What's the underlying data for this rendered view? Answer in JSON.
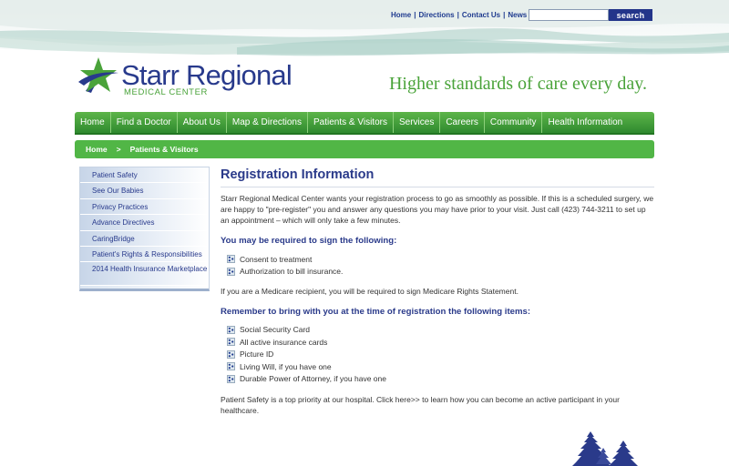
{
  "utility_nav": {
    "links": [
      "Home",
      "Directions",
      "Contact Us",
      "News"
    ],
    "separator": "|",
    "search_placeholder": "",
    "search_button": "search"
  },
  "logo": {
    "name": "Starr Regional",
    "subtitle": "MEDICAL CENTER",
    "icon": "star-logo-icon",
    "colors": {
      "blue": "#283a8c",
      "green": "#4aa33a"
    }
  },
  "tagline": "Higher standards of care every day.",
  "main_nav": [
    "Home",
    "Find a Doctor",
    "About Us",
    "Map & Directions",
    "Patients & Visitors",
    "Services",
    "Careers",
    "Community",
    "Health Information"
  ],
  "breadcrumb": {
    "items": [
      "Home",
      "Patients & Visitors"
    ],
    "separator": ">"
  },
  "sidebar": {
    "items": [
      "Patient Safety",
      "See Our Babies",
      "Privacy Practices",
      "Advance Directives",
      "CaringBridge",
      "Patient's Rights & Responsibilities",
      "2014 Health Insurance Marketplace"
    ]
  },
  "content": {
    "title": "Registration Information",
    "intro": "Starr Regional Medical Center wants your registration process to go as smoothly as possible. If this is a scheduled surgery, we are happy to \"pre-register\" you and answer any questions you may have prior to your visit. Just call (423) 744-3211 to set up an appointment – which will only take a few minutes.",
    "sign_heading": "You may be required to sign the following:",
    "sign_items": [
      "Consent to treatment",
      "Authorization to bill insurance."
    ],
    "medicare_note": "If you are a Medicare recipient, you will be required to sign Medicare Rights Statement.",
    "bring_heading": "Remember to bring with you at the time of registration the following items:",
    "bring_items": [
      "Social Security Card",
      "All active insurance cards",
      "Picture ID",
      "Living Will, if you have one",
      "Durable Power of Attorney, if you have one"
    ],
    "safety_note": "Patient Safety is a top priority at our hospital. Click here>> to learn how you can become an active participant in your healthcare."
  },
  "colors": {
    "nav_green": "#3c9a38",
    "crumb_green": "#51b646",
    "heading_blue": "#2a3a8a"
  }
}
